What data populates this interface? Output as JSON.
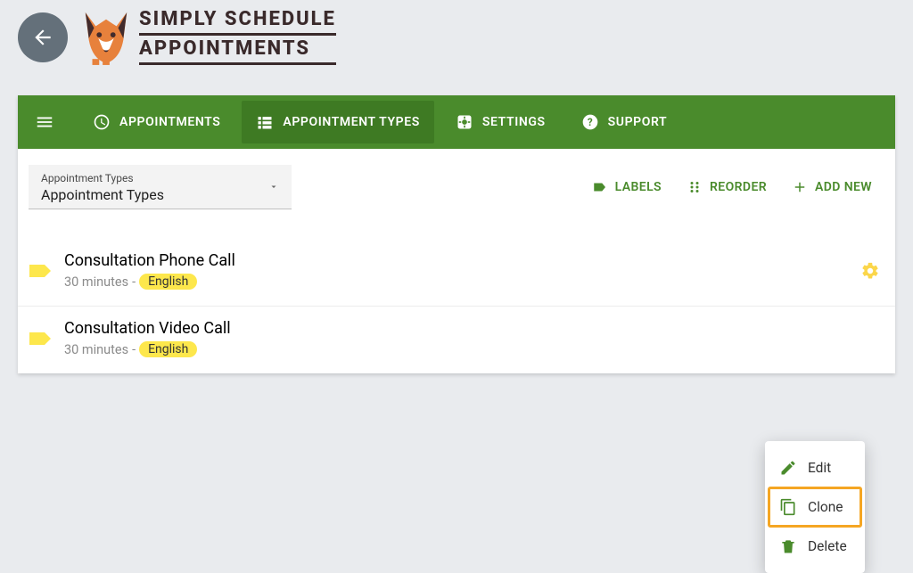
{
  "brand": {
    "line1": "SIMPLY SCHEDULE",
    "line2": "APPOINTMENTS"
  },
  "nav": {
    "items": [
      {
        "label": "APPOINTMENTS"
      },
      {
        "label": "APPOINTMENT TYPES"
      },
      {
        "label": "SETTINGS"
      },
      {
        "label": "SUPPORT"
      }
    ],
    "active_index": 1
  },
  "dropdown": {
    "label": "Appointment Types",
    "value": "Appointment Types"
  },
  "toolbar": {
    "labels_btn": "LABELS",
    "reorder_btn": "REORDER",
    "addnew_btn": "ADD NEW"
  },
  "list": {
    "items": [
      {
        "title": "Consultation Phone Call",
        "duration": "30 minutes",
        "chip": "English"
      },
      {
        "title": "Consultation Video Call",
        "duration": "30 minutes",
        "chip": "English"
      }
    ]
  },
  "popup": {
    "edit": "Edit",
    "clone": "Clone",
    "delete": "Delete",
    "highlight": "clone"
  }
}
